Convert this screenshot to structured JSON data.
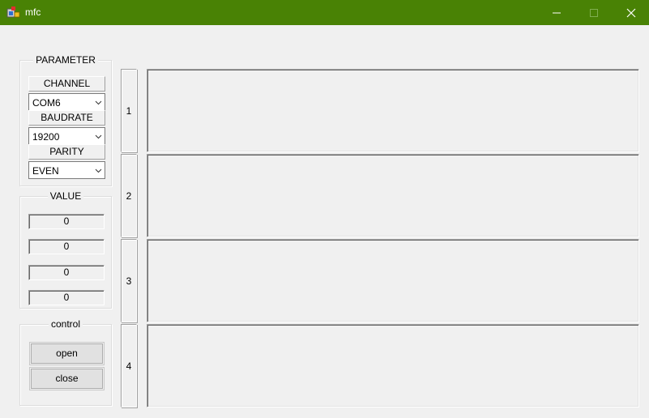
{
  "window": {
    "title": "mfc",
    "accent": "#498205"
  },
  "parameter": {
    "title": "PARAMETER",
    "channel_label": "CHANNEL",
    "channel_value": "COM6",
    "baud_label": "BAUDRATE",
    "baud_value": "19200",
    "parity_label": "PARITY",
    "parity_value": "EVEN"
  },
  "value_group": {
    "title": "VALUE",
    "values": [
      "0",
      "0",
      "0",
      "0"
    ]
  },
  "control": {
    "title": "control",
    "open_label": "open",
    "close_label": "close"
  },
  "channels": [
    "1",
    "2",
    "3",
    "4"
  ]
}
